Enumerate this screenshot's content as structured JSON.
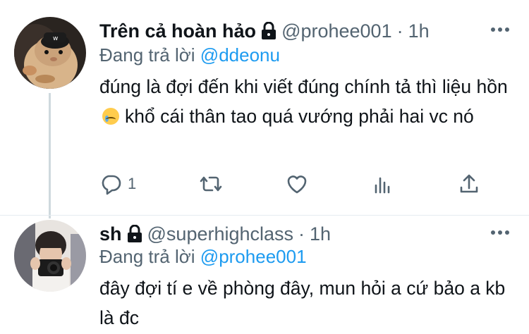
{
  "tweets": [
    {
      "display_name": "Trên cả hoàn hảo",
      "handle": "@prohee001",
      "separator": "·",
      "time": "1h",
      "replying_prefix": "Đang trả lời",
      "replying_to": "@ddeonu",
      "text_before_emoji": "đúng là đợi đến khi viết đúng chính tả thì liệu hồn",
      "emoji": "sad-tear-emoji",
      "text_after_emoji": "khổ cái thân tao quá vướng phải hai vc nó",
      "reply_count": "1",
      "icons": [
        "reply-icon",
        "retweet-icon",
        "like-icon",
        "analytics-icon",
        "share-icon"
      ]
    },
    {
      "display_name": "sh",
      "handle": "@superhighclass",
      "separator": "·",
      "time": "1h",
      "replying_prefix": "Đang trả lời",
      "replying_to": "@prohee001",
      "text": "đây đợi tí e về phòng đây, mun hỏi a cứ bảo a kb là đc"
    }
  ],
  "colors": {
    "link": "#1d9bf0",
    "muted": "#536471",
    "thread_line": "#cfd9de"
  }
}
